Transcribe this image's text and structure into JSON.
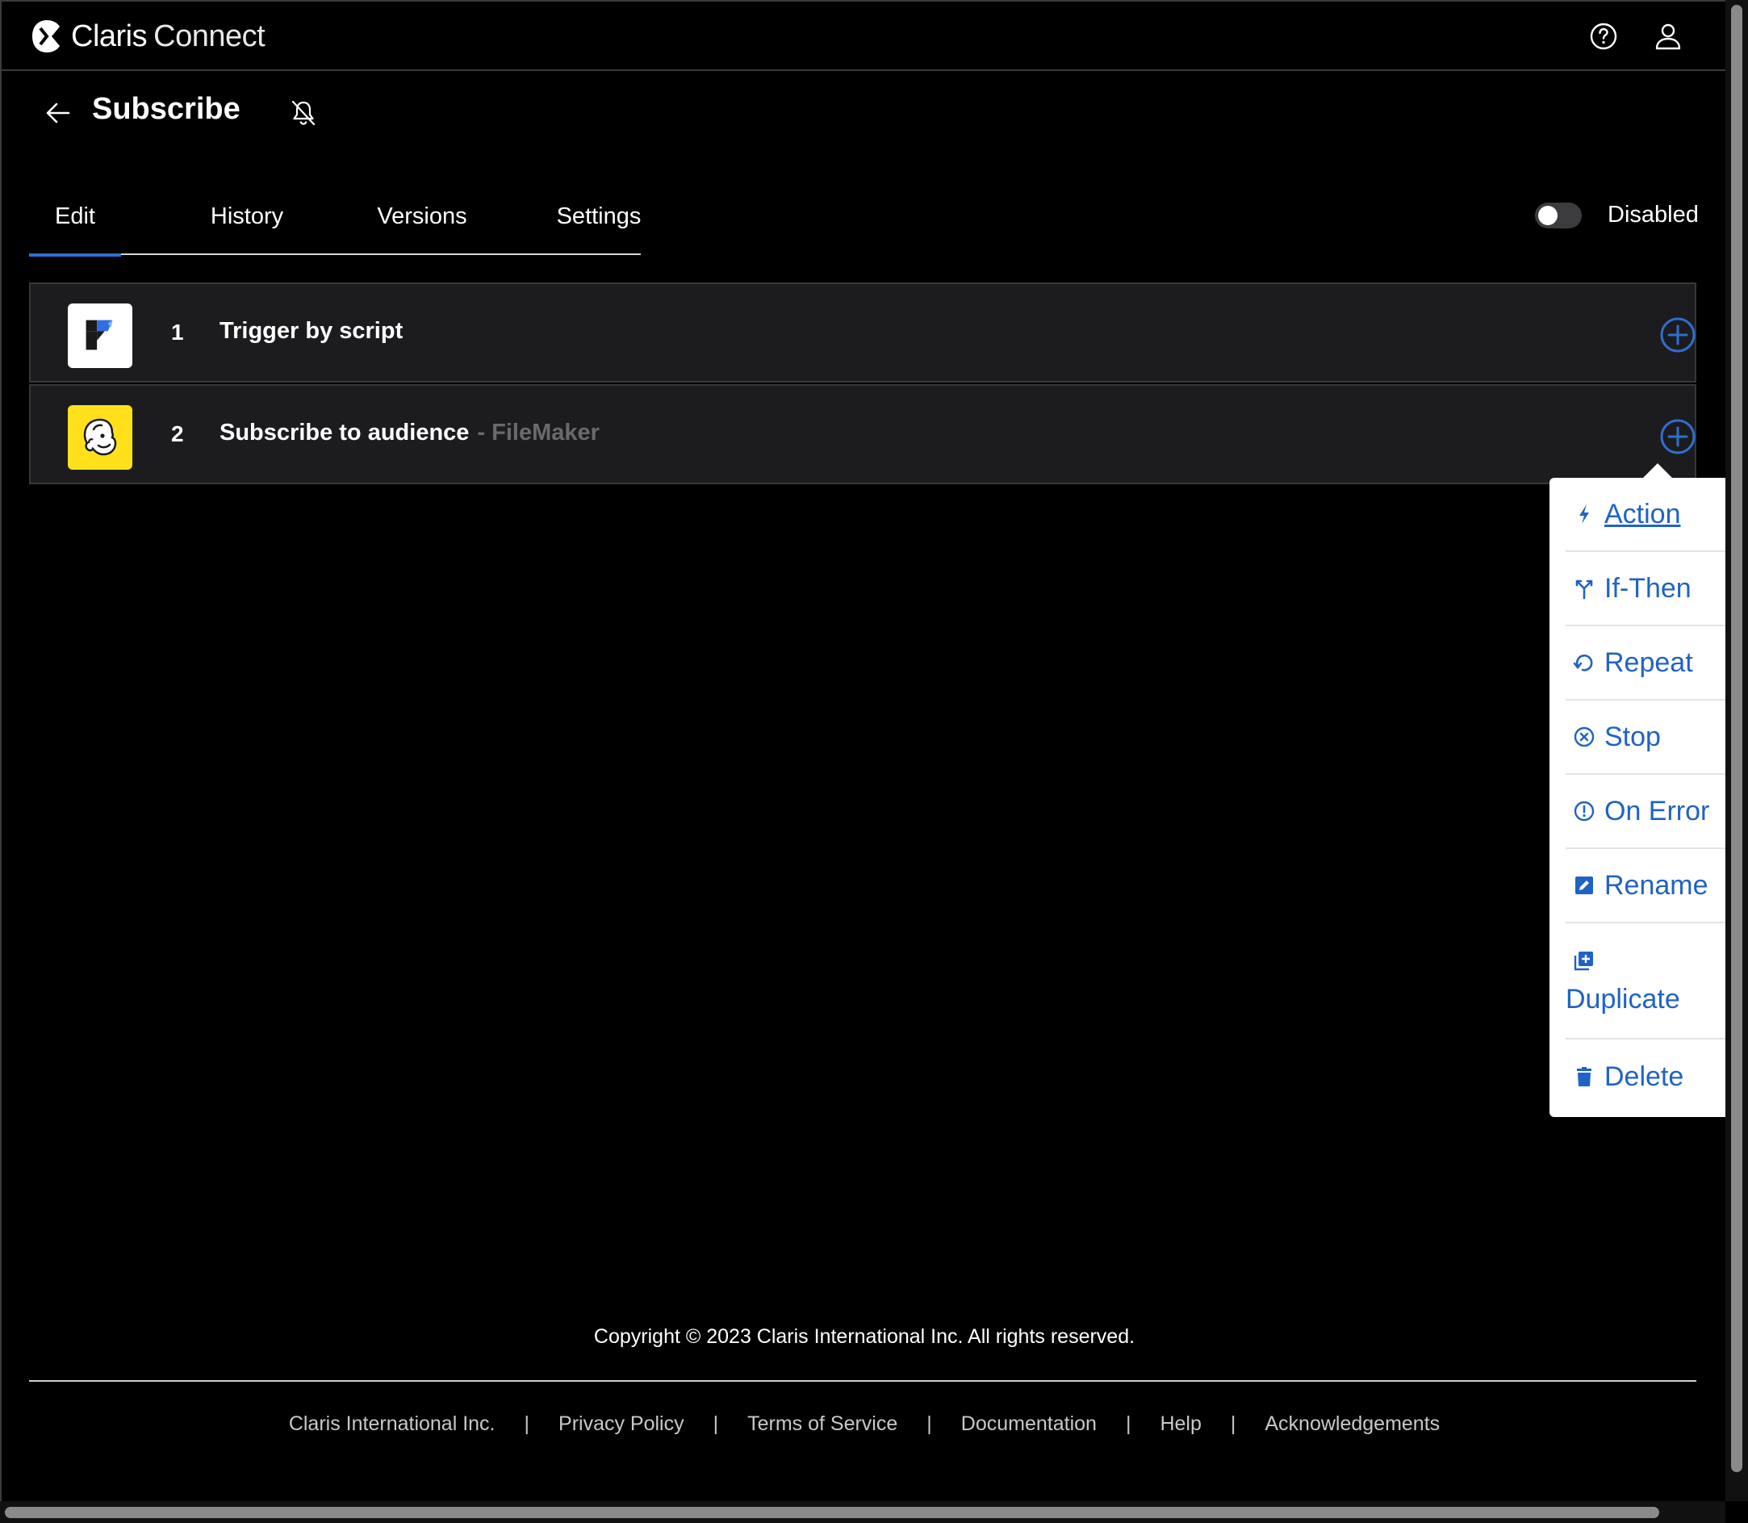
{
  "header": {
    "brand_primary": "Claris",
    "brand_secondary": "Connect",
    "help_icon": "question-circle-icon",
    "account_icon": "user-icon"
  },
  "page": {
    "title": "Subscribe",
    "back_icon": "arrow-left-icon",
    "notification_icon": "bell-off-icon"
  },
  "tabs": [
    {
      "label": "Edit",
      "active": true
    },
    {
      "label": "History",
      "active": false
    },
    {
      "label": "Versions",
      "active": false
    },
    {
      "label": "Settings",
      "active": false
    }
  ],
  "status_toggle": {
    "label": "Disabled",
    "on": false
  },
  "steps": [
    {
      "number": "1",
      "title": "Trigger by script",
      "subtitle": "",
      "icon": "filemaker-icon"
    },
    {
      "number": "2",
      "title": "Subscribe to audience",
      "subtitle": "- FileMaker",
      "icon": "mailchimp-icon"
    }
  ],
  "add_step_icon": "plus-circle-icon",
  "menu": {
    "items": [
      {
        "label": "Action",
        "icon": "bolt-icon"
      },
      {
        "label": "If-Then",
        "icon": "branch-icon"
      },
      {
        "label": "Repeat",
        "icon": "repeat-icon"
      },
      {
        "label": "Stop",
        "icon": "stop-circle-icon"
      },
      {
        "label": "On Error",
        "icon": "alert-circle-icon"
      },
      {
        "label": "Rename",
        "icon": "edit-icon"
      },
      {
        "label": "Duplicate",
        "icon": "duplicate-icon"
      },
      {
        "label": "Delete",
        "icon": "trash-icon"
      }
    ]
  },
  "footer": {
    "copyright": "Copyright © 2023 Claris International Inc. All rights reserved.",
    "links": [
      "Claris International Inc.",
      "Privacy Policy",
      "Terms of Service",
      "Documentation",
      "Help",
      "Acknowledgements"
    ],
    "separator": "|"
  },
  "colors": {
    "background": "#000000",
    "panel": "#1c1c1e",
    "accent": "#2e6fd1",
    "menu_text": "#1f63c4",
    "mailchimp_yellow": "#ffe01b"
  }
}
